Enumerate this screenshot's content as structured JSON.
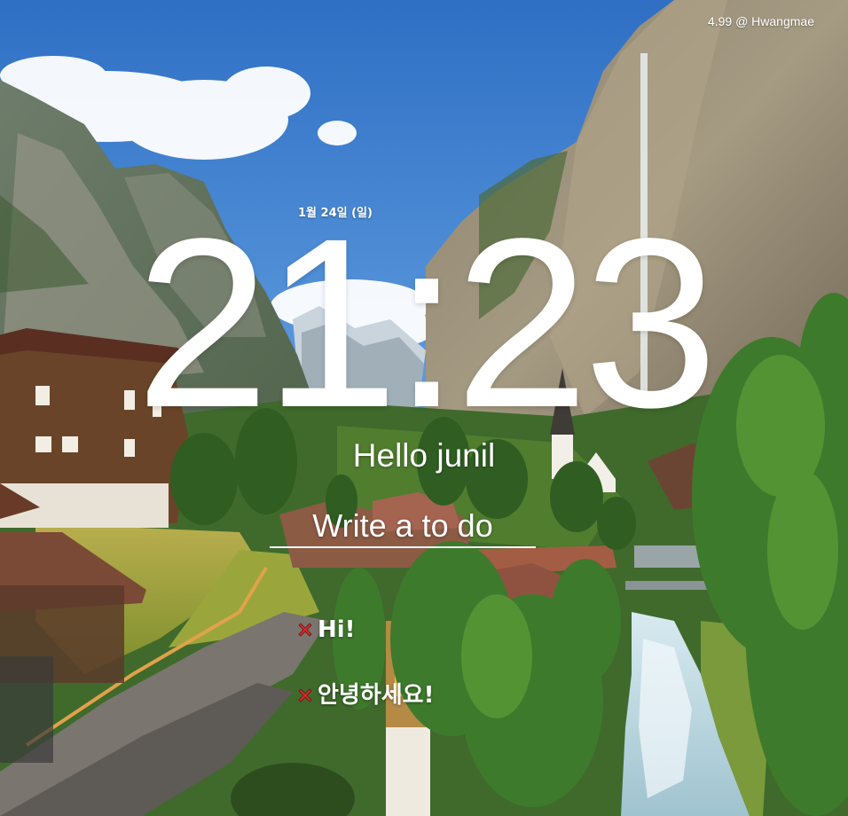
{
  "weather": {
    "text": "4.99 @ Hwangmae"
  },
  "date": {
    "text": "1월 24일 (일)"
  },
  "clock": {
    "time": "21:23"
  },
  "greeting": {
    "text": "Hello junil"
  },
  "todo_form": {
    "placeholder": "Write a to do",
    "value": ""
  },
  "todos": [
    {
      "text": "Hi!",
      "delete_icon": "x-icon"
    },
    {
      "text": "안녕하세요!",
      "delete_icon": "x-icon"
    }
  ],
  "colors": {
    "text": "#ffffff",
    "delete_icon_fill": "#e02626",
    "delete_icon_border": "#5a1a1a",
    "sky": "#4f8fd6"
  },
  "background": {
    "icon": "landscape-photo",
    "scene": "alpine-valley-photo"
  }
}
